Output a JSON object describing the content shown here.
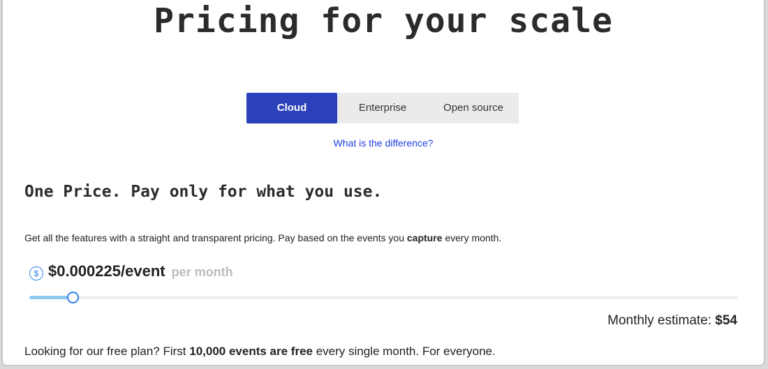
{
  "page": {
    "title": "Pricing for your scale"
  },
  "tabs": {
    "items": [
      {
        "label": "Cloud",
        "active": true
      },
      {
        "label": "Enterprise",
        "active": false
      },
      {
        "label": "Open source",
        "active": false
      }
    ]
  },
  "link": {
    "difference": "What is the difference?"
  },
  "section": {
    "heading": "One Price. Pay only for what you use.",
    "description_prefix": "Get all the features with a straight and transparent pricing. Pay based on the events you ",
    "description_bold": "capture",
    "description_suffix": " every month."
  },
  "pricing": {
    "icon": "dollar-icon",
    "price": "$0.000225/event",
    "period": "per month"
  },
  "slider": {
    "value_fraction": 0.06
  },
  "estimate": {
    "label": "Monthly estimate: ",
    "value": "$54"
  },
  "free_plan": {
    "prefix": "Looking for our free plan? First ",
    "bold": "10,000 events are free",
    "suffix": " every single month. For everyone."
  },
  "colors": {
    "accent": "#2c41b9",
    "link": "#1e3fe0",
    "slider": "#2f80ed"
  }
}
